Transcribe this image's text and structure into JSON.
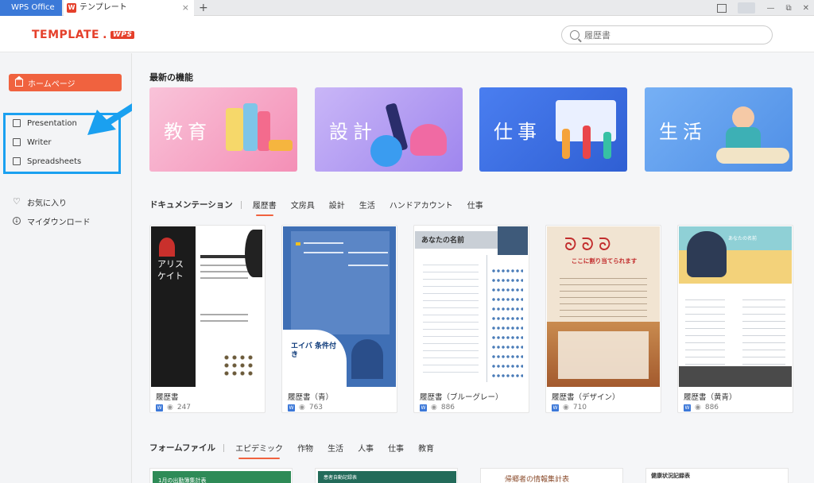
{
  "tabs": {
    "wps_office": "WPS Office",
    "template": "テンプレート",
    "template_icon": "W",
    "close": "×",
    "add": "+"
  },
  "window": {
    "minimize": "—",
    "restore": "⧉",
    "close": "✕"
  },
  "header": {
    "logo_main": "TEMPLATE",
    "logo_dot": ".",
    "logo_wps": "WPS",
    "search_placeholder": "履歴書"
  },
  "sidebar": {
    "home": "ホームページ",
    "items": [
      {
        "label": "Presentation",
        "icon": "presentation-icon"
      },
      {
        "label": "Writer",
        "icon": "writer-icon"
      },
      {
        "label": "Spreadsheets",
        "icon": "spreadsheets-icon"
      }
    ],
    "favorites": "お気に入り",
    "downloads": "マイダウンロード"
  },
  "latest": {
    "title": "最新の機能",
    "banners": [
      {
        "label": "教育",
        "color": "#f7a6c6"
      },
      {
        "label": "設計",
        "color": "#b9a2f0"
      },
      {
        "label": "仕事",
        "color": "#3b6fe0"
      },
      {
        "label": "生活",
        "color": "#5c9cef"
      }
    ]
  },
  "docs": {
    "title": "ドキュメンテーション",
    "filters": [
      "履歴書",
      "文房具",
      "設計",
      "生活",
      "ハンドアカウント",
      "仕事"
    ],
    "active_filter": "履歴書",
    "cards": [
      {
        "name": "履歴書",
        "views": "247",
        "thumb_title": "アリス ケイト"
      },
      {
        "name": "履歴書（青）",
        "views": "763",
        "thumb_title": "エイバ 条件付き"
      },
      {
        "name": "履歴書（ブルーグレー）",
        "views": "886",
        "thumb_title": "あなたの名前"
      },
      {
        "name": "履歴書（デザイン）",
        "views": "710",
        "thumb_title": "ここに割り当てられます"
      },
      {
        "name": "履歴書（黄青）",
        "views": "886",
        "thumb_title": "あなたの名前"
      }
    ]
  },
  "forms": {
    "title": "フォームファイル",
    "filters": [
      "エピデミック",
      "作物",
      "生活",
      "人事",
      "仕事",
      "教育"
    ],
    "active_filter": "エピデミック",
    "cards": [
      "1月の出勤簿集計表",
      "患者自動記録表",
      "帰郷者の情報集計表",
      "健康状況記録表"
    ]
  }
}
